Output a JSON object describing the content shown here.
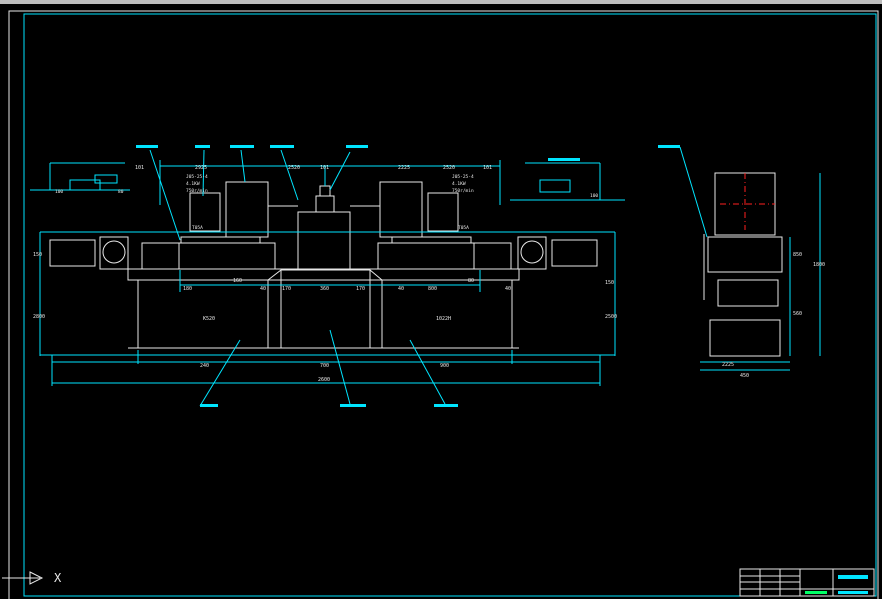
{
  "drawing": {
    "bg": "#000000",
    "line_color": "#00e5ff",
    "part_color": "#e8e8e8",
    "center_color": "#ff2020",
    "dims_top": [
      "101",
      "2925",
      "2520",
      "101",
      "2225",
      "2520",
      "101"
    ],
    "dims_mid": [
      "180",
      "160",
      "40",
      "170",
      "360",
      "170",
      "40",
      "800",
      "80",
      "40"
    ],
    "dims_bottom": [
      "240",
      "700",
      "900"
    ],
    "dim_total": "2600",
    "dims_left": [
      "150",
      "2800"
    ],
    "dims_right": [
      "150",
      "2500"
    ],
    "unit_labels": [
      "K520",
      "1022H"
    ],
    "side_dims": {
      "top": "850",
      "bottom": "560",
      "total": "1800",
      "base": "2225",
      "width": "450"
    },
    "small_dims": [
      "100",
      "80",
      "100"
    ],
    "motor_labels": [
      "T05A",
      "T05A"
    ],
    "spec_left": [
      "J05-25-4",
      "4.1KW",
      "750r/min"
    ],
    "spec_right": [
      "J05-25-4",
      "4.1KW",
      "750r/min"
    ]
  },
  "axis": {
    "label": "X"
  }
}
